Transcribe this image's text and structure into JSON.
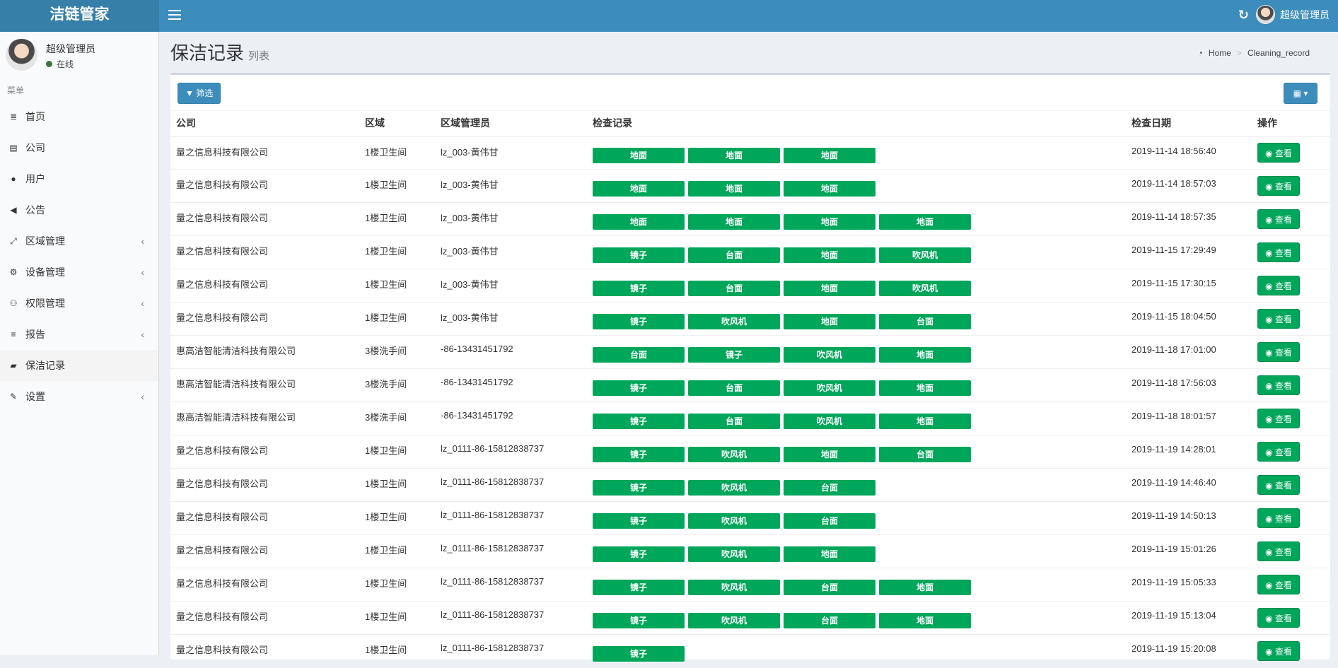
{
  "app": {
    "brand": "洁链管家"
  },
  "topbar": {
    "refresh_icon": "refresh-icon",
    "user_name": "超级管理员"
  },
  "sidebar": {
    "user_name": "超级管理员",
    "status": "在线",
    "menu_header": "菜单",
    "items": [
      {
        "label": "首页",
        "icon": "≣",
        "caret": ""
      },
      {
        "label": "公司",
        "icon": "▤",
        "caret": ""
      },
      {
        "label": "用户",
        "icon": "●",
        "caret": ""
      },
      {
        "label": "公告",
        "icon": "◀",
        "caret": ""
      },
      {
        "label": "区域管理",
        "icon": "⤢",
        "caret": "‹"
      },
      {
        "label": "设备管理",
        "icon": "⚙",
        "caret": "‹"
      },
      {
        "label": "权限管理",
        "icon": "⚇",
        "caret": "‹"
      },
      {
        "label": "报告",
        "icon": "≡",
        "caret": "‹"
      },
      {
        "label": "保洁记录",
        "icon": "▰",
        "caret": ""
      },
      {
        "label": "设置",
        "icon": "✎",
        "caret": "‹"
      }
    ],
    "active_index": 8
  },
  "header": {
    "title": "保洁记录",
    "subtitle": "列表",
    "breadcrumb": [
      "Home",
      "Cleaning_record"
    ]
  },
  "toolbar": {
    "filter_label": "▼ 筛选",
    "columns_label": "▦ ▾"
  },
  "table": {
    "columns": [
      "公司",
      "区域",
      "区域管理员",
      "检查记录",
      "检查日期",
      "操作"
    ],
    "view_label": "◉ 查看",
    "rows": [
      {
        "company": "量之信息科技有限公司",
        "area": "1楼卫生间",
        "manager": "lz_003-黄伟甘",
        "records": [
          "地面",
          "地面",
          "地面"
        ],
        "date": "2019-11-14 18:56:40"
      },
      {
        "company": "量之信息科技有限公司",
        "area": "1楼卫生间",
        "manager": "lz_003-黄伟甘",
        "records": [
          "地面",
          "地面",
          "地面"
        ],
        "date": "2019-11-14 18:57:03"
      },
      {
        "company": "量之信息科技有限公司",
        "area": "1楼卫生间",
        "manager": "lz_003-黄伟甘",
        "records": [
          "地面",
          "地面",
          "地面",
          "地面"
        ],
        "date": "2019-11-14 18:57:35"
      },
      {
        "company": "量之信息科技有限公司",
        "area": "1楼卫生间",
        "manager": "lz_003-黄伟甘",
        "records": [
          "镜子",
          "台面",
          "地面",
          "吹风机"
        ],
        "date": "2019-11-15 17:29:49"
      },
      {
        "company": "量之信息科技有限公司",
        "area": "1楼卫生间",
        "manager": "lz_003-黄伟甘",
        "records": [
          "镜子",
          "台面",
          "地面",
          "吹风机"
        ],
        "date": "2019-11-15 17:30:15"
      },
      {
        "company": "量之信息科技有限公司",
        "area": "1楼卫生间",
        "manager": "lz_003-黄伟甘",
        "records": [
          "镜子",
          "吹风机",
          "地面",
          "台面"
        ],
        "date": "2019-11-15 18:04:50"
      },
      {
        "company": "惠高洁智能清洁科技有限公司",
        "area": "3楼洗手间",
        "manager": "-86-13431451792",
        "records": [
          "台面",
          "镜子",
          "吹风机",
          "地面"
        ],
        "date": "2019-11-18 17:01:00"
      },
      {
        "company": "惠高洁智能清洁科技有限公司",
        "area": "3楼洗手间",
        "manager": "-86-13431451792",
        "records": [
          "镜子",
          "台面",
          "吹风机",
          "地面"
        ],
        "date": "2019-11-18 17:56:03"
      },
      {
        "company": "惠高洁智能清洁科技有限公司",
        "area": "3楼洗手间",
        "manager": "-86-13431451792",
        "records": [
          "镜子",
          "台面",
          "吹风机",
          "地面"
        ],
        "date": "2019-11-18 18:01:57"
      },
      {
        "company": "量之信息科技有限公司",
        "area": "1楼卫生间",
        "manager": "lz_0111-86-15812838737",
        "records": [
          "镜子",
          "吹风机",
          "地面",
          "台面"
        ],
        "date": "2019-11-19 14:28:01"
      },
      {
        "company": "量之信息科技有限公司",
        "area": "1楼卫生间",
        "manager": "lz_0111-86-15812838737",
        "records": [
          "镜子",
          "吹风机",
          "台面"
        ],
        "date": "2019-11-19 14:46:40"
      },
      {
        "company": "量之信息科技有限公司",
        "area": "1楼卫生间",
        "manager": "lz_0111-86-15812838737",
        "records": [
          "镜子",
          "吹风机",
          "台面"
        ],
        "date": "2019-11-19 14:50:13"
      },
      {
        "company": "量之信息科技有限公司",
        "area": "1楼卫生间",
        "manager": "lz_0111-86-15812838737",
        "records": [
          "镜子",
          "吹风机",
          "地面"
        ],
        "date": "2019-11-19 15:01:26"
      },
      {
        "company": "量之信息科技有限公司",
        "area": "1楼卫生间",
        "manager": "lz_0111-86-15812838737",
        "records": [
          "镜子",
          "吹风机",
          "台面",
          "地面"
        ],
        "date": "2019-11-19 15:05:33"
      },
      {
        "company": "量之信息科技有限公司",
        "area": "1楼卫生间",
        "manager": "lz_0111-86-15812838737",
        "records": [
          "镜子",
          "吹风机",
          "台面",
          "地面"
        ],
        "date": "2019-11-19 15:13:04"
      },
      {
        "company": "量之信息科技有限公司",
        "area": "1楼卫生间",
        "manager": "lz_0111-86-15812838737",
        "records": [
          "镜子"
        ],
        "date": "2019-11-19 15:20:08"
      }
    ]
  }
}
